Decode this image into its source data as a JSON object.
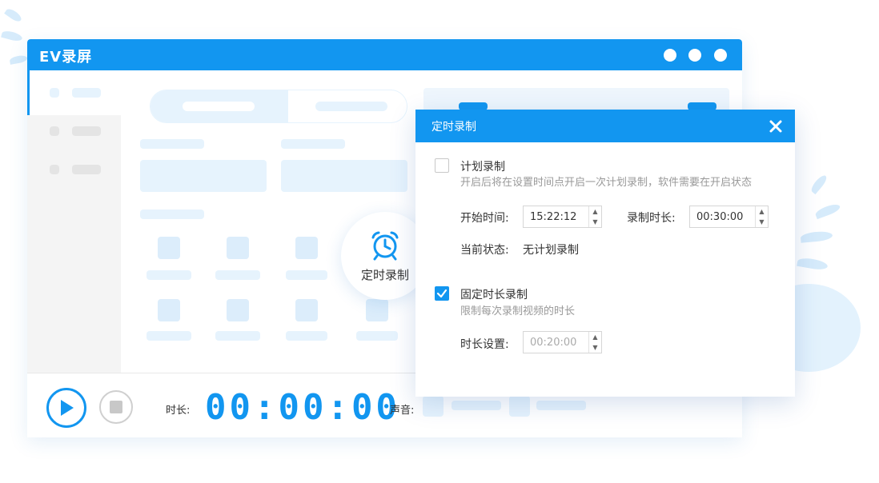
{
  "window": {
    "title": "EV录屏"
  },
  "badge": {
    "label": "定时录制"
  },
  "bottom": {
    "duration_label": "时长:",
    "timer": "00:00:00",
    "sound_label": "声音:"
  },
  "dialog": {
    "title": "定时录制",
    "scheduled": {
      "checked": false,
      "title": "计划录制",
      "description": "开启后将在设置时间点开启一次计划录制，软件需要在开启状态",
      "start_label": "开始时间:",
      "start_value": "15:22:12",
      "duration_label": "录制时长:",
      "duration_value": "00:30:00",
      "status_label": "当前状态:",
      "status_value": "无计划录制"
    },
    "fixed": {
      "checked": true,
      "title": "固定时长录制",
      "description": "限制每次录制视频的时长",
      "setting_label": "时长设置:",
      "setting_value": "00:20:00"
    }
  },
  "colors": {
    "accent": "#1296f0",
    "placeholder": "#e6f3fd"
  },
  "icons": [
    "alarm-clock-icon",
    "close-icon",
    "play-icon",
    "stop-icon",
    "check-icon",
    "arrow-up-icon",
    "arrow-down-icon"
  ]
}
